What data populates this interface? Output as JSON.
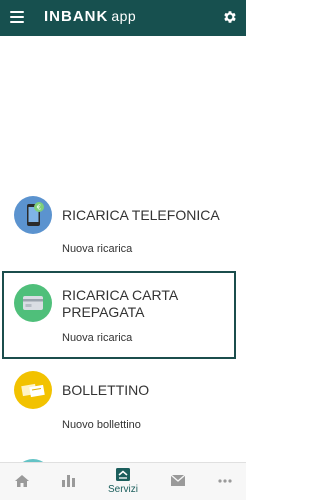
{
  "header": {
    "brand_name": "INBANK",
    "brand_suffix": "app",
    "menu_icon": "hamburger-menu-icon",
    "settings_icon": "gear-icon"
  },
  "services": [
    {
      "title": "RICARICA TELEFONICA",
      "subtitle": "Nuova ricarica",
      "icon": "phone-euro-icon",
      "icon_bg": "#5b93cf"
    },
    {
      "title": "RICARICA CARTA PREPAGATA",
      "subtitle": "Nuova ricarica",
      "icon": "credit-card-icon",
      "icon_bg": "#4fbf7a",
      "selected": true
    },
    {
      "title": "BOLLETTINO",
      "subtitle": "Nuovo bollettino",
      "icon": "bill-icon",
      "icon_bg": "#f2c200"
    }
  ],
  "bottom_nav": {
    "active_label": "Servizi",
    "items": [
      "home-icon",
      "chart-icon",
      "servizi-icon",
      "mail-icon",
      "more-icon"
    ]
  },
  "colors": {
    "header_bg": "#17504f",
    "accent": "#1b5e5c"
  }
}
